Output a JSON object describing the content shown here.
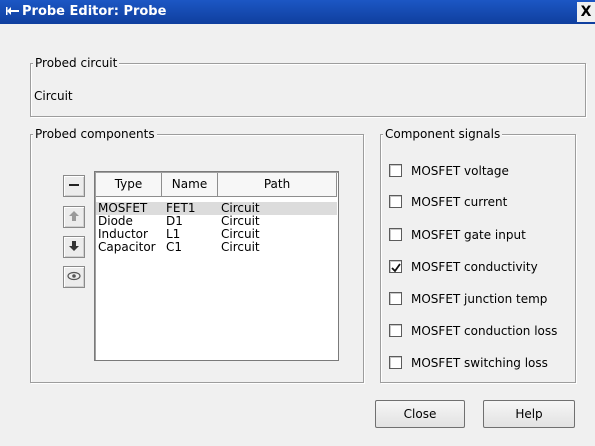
{
  "window": {
    "title": "Probe Editor: Probe",
    "close_glyph": "X",
    "icon": "probe-icon"
  },
  "probed_circuit": {
    "legend": "Probed circuit",
    "value": "Circuit"
  },
  "probed_components": {
    "legend": "Probed components",
    "buttons": [
      {
        "name": "remove-button",
        "icon": "minus-icon"
      },
      {
        "name": "move-up-button",
        "icon": "arrow-up-icon"
      },
      {
        "name": "move-down-button",
        "icon": "arrow-down-icon"
      },
      {
        "name": "view-button",
        "icon": "eye-icon"
      }
    ],
    "columns": [
      "Type",
      "Name",
      "Path"
    ],
    "rows": [
      {
        "type": "MOSFET",
        "name": "FET1",
        "path": "Circuit",
        "selected": true
      },
      {
        "type": "Diode",
        "name": "D1",
        "path": "Circuit",
        "selected": false
      },
      {
        "type": "Inductor",
        "name": "L1",
        "path": "Circuit",
        "selected": false
      },
      {
        "type": "Capacitor",
        "name": "C1",
        "path": "Circuit",
        "selected": false
      }
    ]
  },
  "component_signals": {
    "legend": "Component signals",
    "items": [
      {
        "label": "MOSFET voltage",
        "checked": false
      },
      {
        "label": "MOSFET current",
        "checked": false
      },
      {
        "label": "MOSFET gate input",
        "checked": false
      },
      {
        "label": "MOSFET conductivity",
        "checked": true
      },
      {
        "label": "MOSFET junction temp",
        "checked": false
      },
      {
        "label": "MOSFET conduction loss",
        "checked": false
      },
      {
        "label": "MOSFET switching loss",
        "checked": false
      }
    ]
  },
  "actions": {
    "close_label": "Close",
    "help_label": "Help"
  },
  "colors": {
    "title_bar": "#1c57c4",
    "dialog_bg": "#f0f0f0",
    "selection": "#dcdcdc"
  }
}
